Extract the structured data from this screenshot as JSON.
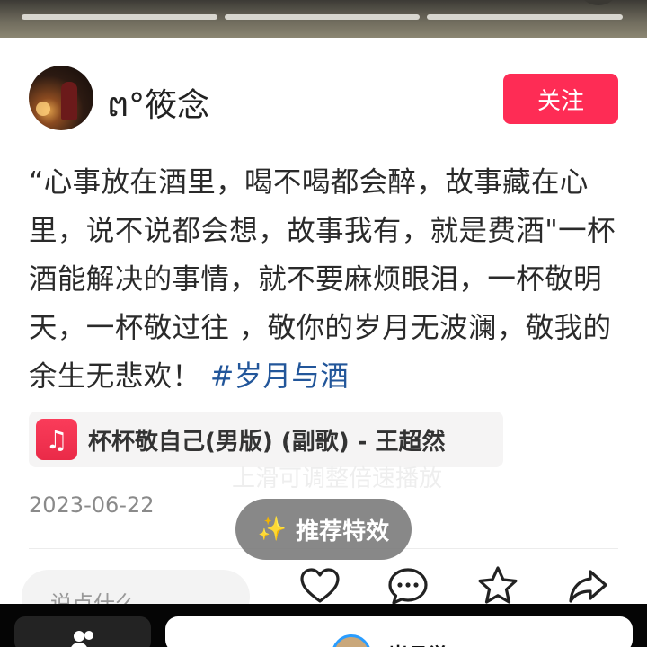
{
  "author": {
    "avatar_icon": "user-avatar",
    "name": "ຕ°筱念"
  },
  "follow_button": {
    "label": "关注",
    "color": "#fe2c55"
  },
  "caption": {
    "text": "“心事放在酒里，喝不喝都会醉，故事藏在心里，说不说都会想，故事我有，就是费酒\"一杯酒能解决的事情，就不要麻烦眼泪，一杯敬明天，一杯敬过往 ，敬你的岁月无波澜，敬我的余生无悲欢！",
    "hashtag": "#岁月与酒"
  },
  "music": {
    "icon": "music-note-icon",
    "title": "杯杯敬自己(男版) (副歌) - 王超然"
  },
  "ghost_text": "上滑可调整倍速播放",
  "date": "2023-06-22",
  "effects_pill": {
    "icon": "sparkle-icon",
    "label": "推荐特效"
  },
  "comment_input": {
    "placeholder": "说点什么..."
  },
  "actions": {
    "like_icon": "heart-icon",
    "comment_icon": "comment-icon",
    "favorite_icon": "star-icon",
    "share_icon": "share-icon"
  },
  "bottom_bar": {
    "friends_icon": "people-icon",
    "name": "岁月觉"
  }
}
